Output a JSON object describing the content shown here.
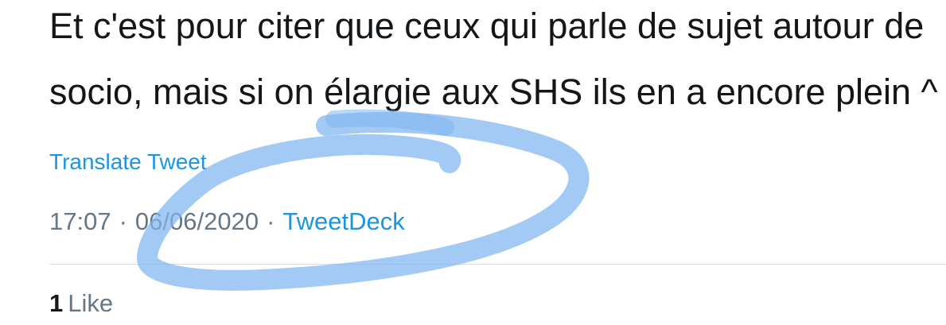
{
  "tweet": {
    "text_line_1": "Et c'est pour citer que ceux qui parle de sujet autour de",
    "text_line_2": "socio, mais si on élargie aux SHS ils en a encore plein ^"
  },
  "translate": {
    "label": "Translate Tweet"
  },
  "meta": {
    "time": "17:07",
    "separator": "·",
    "date": "06/06/2020",
    "source": "TweetDeck"
  },
  "engagement": {
    "like_count": "1",
    "like_label": "Like"
  },
  "colors": {
    "text": "#14171a",
    "muted": "#657786",
    "link": "#1b95e0",
    "highlight": "#7fb6f0"
  },
  "annotation": {
    "type": "hand-drawn highlighter ellipse",
    "icon": "highlight-circle"
  }
}
